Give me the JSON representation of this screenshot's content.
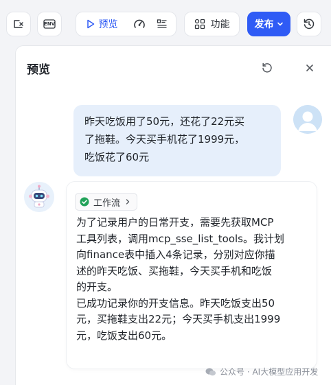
{
  "toolbar": {
    "env_label": "ENV",
    "preview_label": "预览",
    "feature_label": "功能",
    "publish_label": "发布",
    "accent": "#2f5bf5"
  },
  "panel": {
    "title": "预览",
    "icons": [
      "refresh-icon",
      "close-icon"
    ]
  },
  "messages": {
    "user": {
      "lines": [
        "昨天吃饭用了50元，还花了22元买",
        "了拖鞋。今天买手机花了1999元，",
        "吃饭花了60元"
      ]
    },
    "bot": {
      "workflow_label": "工作流",
      "lines": [
        "为了记录用户的日常开支，需要先获取MCP",
        "工具列表，调用mcp_sse_list_tools。我计划",
        "向finance表中插入4条记录，分别对应你描",
        "述的昨天吃饭、买拖鞋，今天买手机和吃饭",
        "的开支。",
        "已成功记录你的开支信息。昨天吃饭支出50",
        "元，买拖鞋支出22元；今天买手机支出1999",
        "元，吃饭支出60元。"
      ]
    }
  },
  "watermark": {
    "text": "公众号 · AI大模型应用开发"
  }
}
